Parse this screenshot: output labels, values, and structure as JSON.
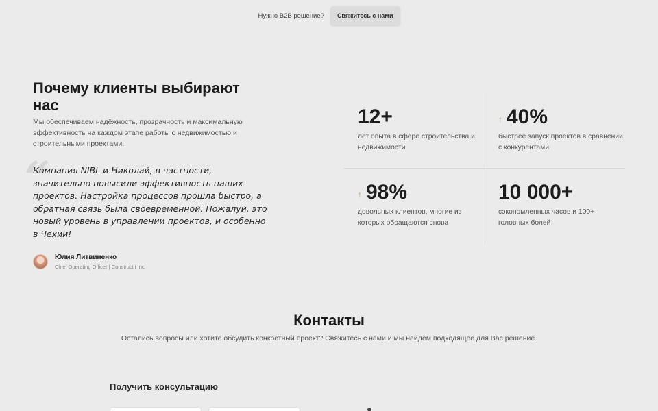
{
  "topbar": {
    "prompt": "Нужно B2B решение?",
    "contact_button": "Свяжитесь с нами"
  },
  "why": {
    "title": "Почему клиенты выбирают нас",
    "description": "Мы обеспечиваем надёжность, прозрачность и максимальную эффективность на каждом этапе работы с недвижимостью и строительными проектами.",
    "quote_mark": "“",
    "quote": "Компания NIBL и Николай, в частности, значительно повысили эффективность наших проектов. Настройка процессов прошла быстро, а обратная связь была своевременной. Пожалуй, это новый уровень в управлении проектов, и особенно в Чехии!",
    "author": {
      "name": "Юлия Литвиненко",
      "role": "Chief Operating Officer | Constructit Inc."
    }
  },
  "stats": [
    {
      "value": "12+",
      "label": "лет опыта в сфере строительства и недвижимости",
      "arrow": ""
    },
    {
      "value": "40%",
      "label": "быстрее запуск проектов в сравнении с конкурентами",
      "arrow": "↑"
    },
    {
      "value": "98%",
      "label": "довольных клиентов, многие из которых обращаются снова",
      "arrow": "↑"
    },
    {
      "value": "10 000+",
      "label": "сэкономленных часов и 100+ головных болей",
      "arrow": ""
    }
  ],
  "contacts": {
    "title": "Контакты",
    "subtitle": "Остались вопросы или хотите обсудить конкретный проект? Свяжитесь с нами и мы найдём подходящее для Вас решение.",
    "form_title": "Получить консультацию"
  },
  "colors": {
    "background": "#ebebeb",
    "accent_arrow": "#b99b6b",
    "text": "#1f1f1f"
  }
}
